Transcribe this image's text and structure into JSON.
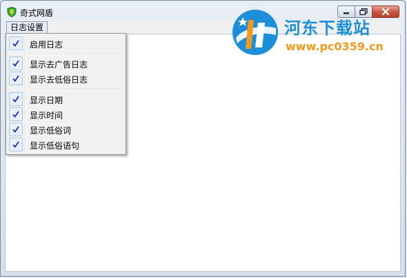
{
  "window": {
    "title": "奇式网盾",
    "icon": "shield-icon",
    "controls": [
      "minimize-icon",
      "maximize-icon",
      "close-icon"
    ]
  },
  "menubar": {
    "items": [
      {
        "label": "日志设置"
      }
    ]
  },
  "dropdown": {
    "items": [
      {
        "label": "启用日志",
        "checked": true
      },
      {
        "label": "显示去广告日志",
        "checked": true
      },
      {
        "label": "显示去低俗日志",
        "checked": true
      },
      {
        "label": "显示日期",
        "checked": true
      },
      {
        "label": "显示时间",
        "checked": true
      },
      {
        "label": "显示低俗词",
        "checked": true
      },
      {
        "label": "显示低俗语句",
        "checked": true
      }
    ]
  },
  "watermark": {
    "title": "河东下载站",
    "url": "www.pc0359.cn",
    "colors": {
      "blue": "#1d8fd8",
      "orange": "#f39a1e"
    }
  },
  "colors": {
    "check": "#1b2aa8",
    "close_button": "#c7533d"
  }
}
